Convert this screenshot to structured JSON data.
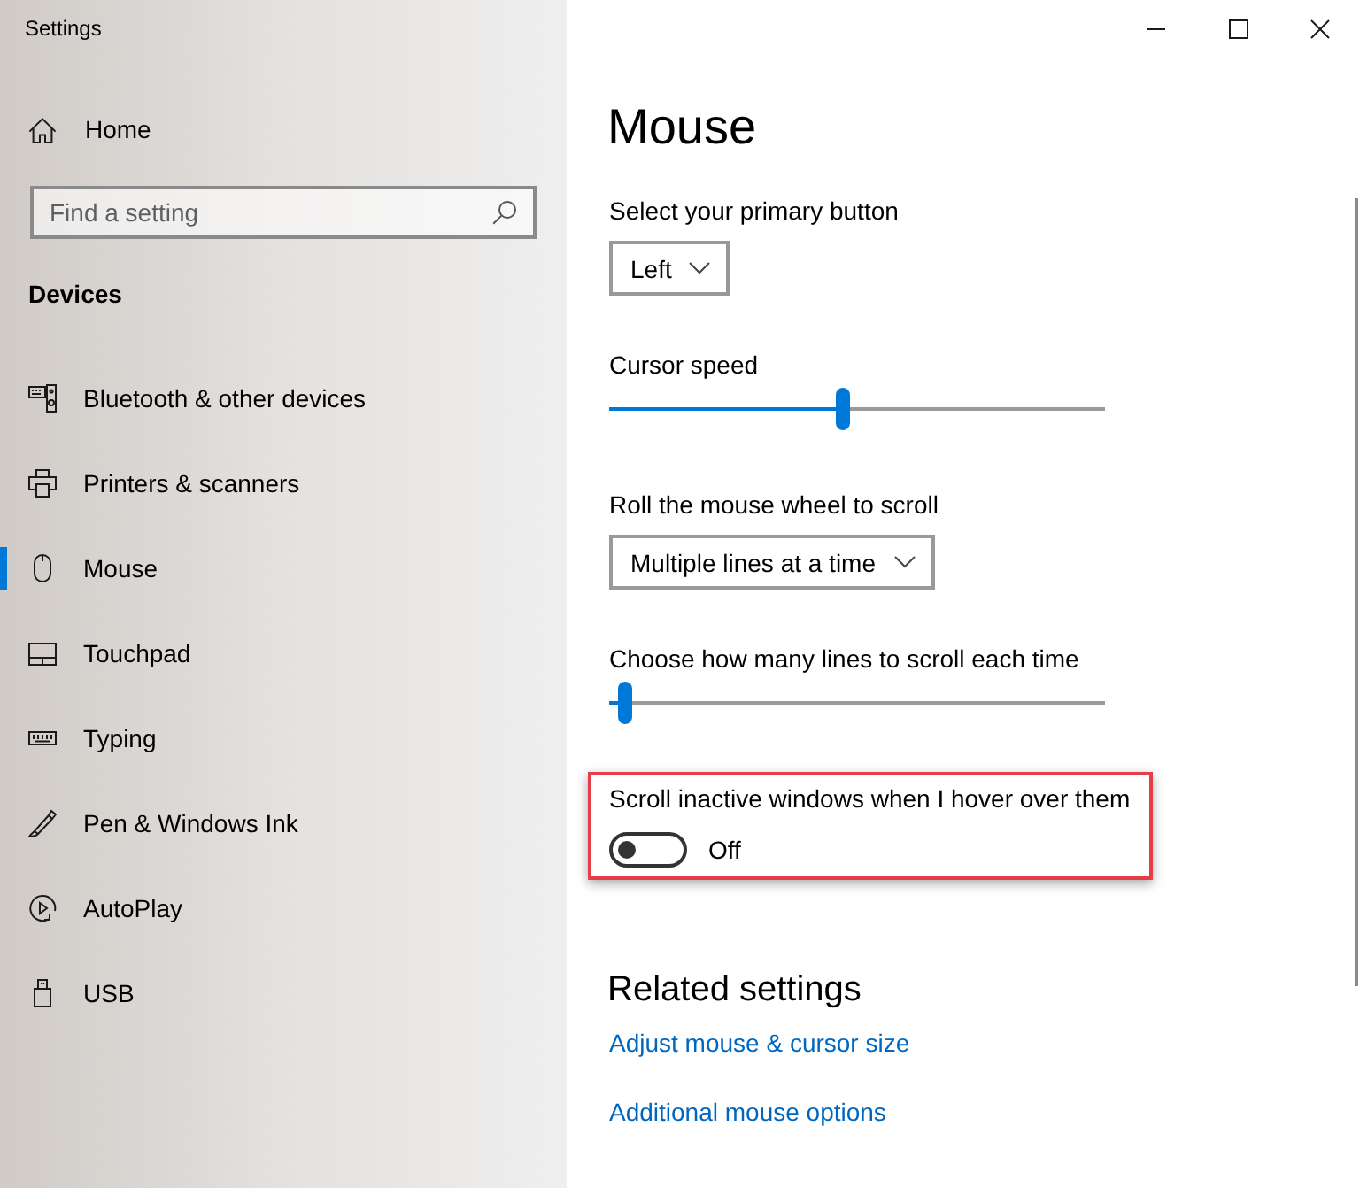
{
  "window": {
    "title": "Settings"
  },
  "sidebar": {
    "home": {
      "label": "Home"
    },
    "search": {
      "placeholder": "Find a setting"
    },
    "section": "Devices",
    "items": [
      {
        "label": "Bluetooth & other devices",
        "selected": false
      },
      {
        "label": "Printers & scanners",
        "selected": false
      },
      {
        "label": "Mouse",
        "selected": true
      },
      {
        "label": "Touchpad",
        "selected": false
      },
      {
        "label": "Typing",
        "selected": false
      },
      {
        "label": "Pen & Windows Ink",
        "selected": false
      },
      {
        "label": "AutoPlay",
        "selected": false
      },
      {
        "label": "USB",
        "selected": false
      }
    ]
  },
  "main": {
    "title": "Mouse",
    "settings": [
      {
        "kind": "dropdown",
        "label": "Select your primary button",
        "value": "Left"
      },
      {
        "kind": "slider",
        "label": "Cursor speed",
        "level": 0.47
      },
      {
        "kind": "dropdown",
        "label": "Roll the mouse wheel to scroll",
        "value": "Multiple lines at a time"
      },
      {
        "kind": "slider",
        "label": "Choose how many lines to scroll each time",
        "level": 0.02
      },
      {
        "kind": "toggle",
        "label": "Scroll inactive windows when I hover over them",
        "on": false,
        "state_text": "Off",
        "highlighted": true
      }
    ],
    "related": {
      "heading": "Related settings",
      "links": [
        "Adjust mouse & cursor size",
        "Additional mouse options"
      ]
    }
  }
}
